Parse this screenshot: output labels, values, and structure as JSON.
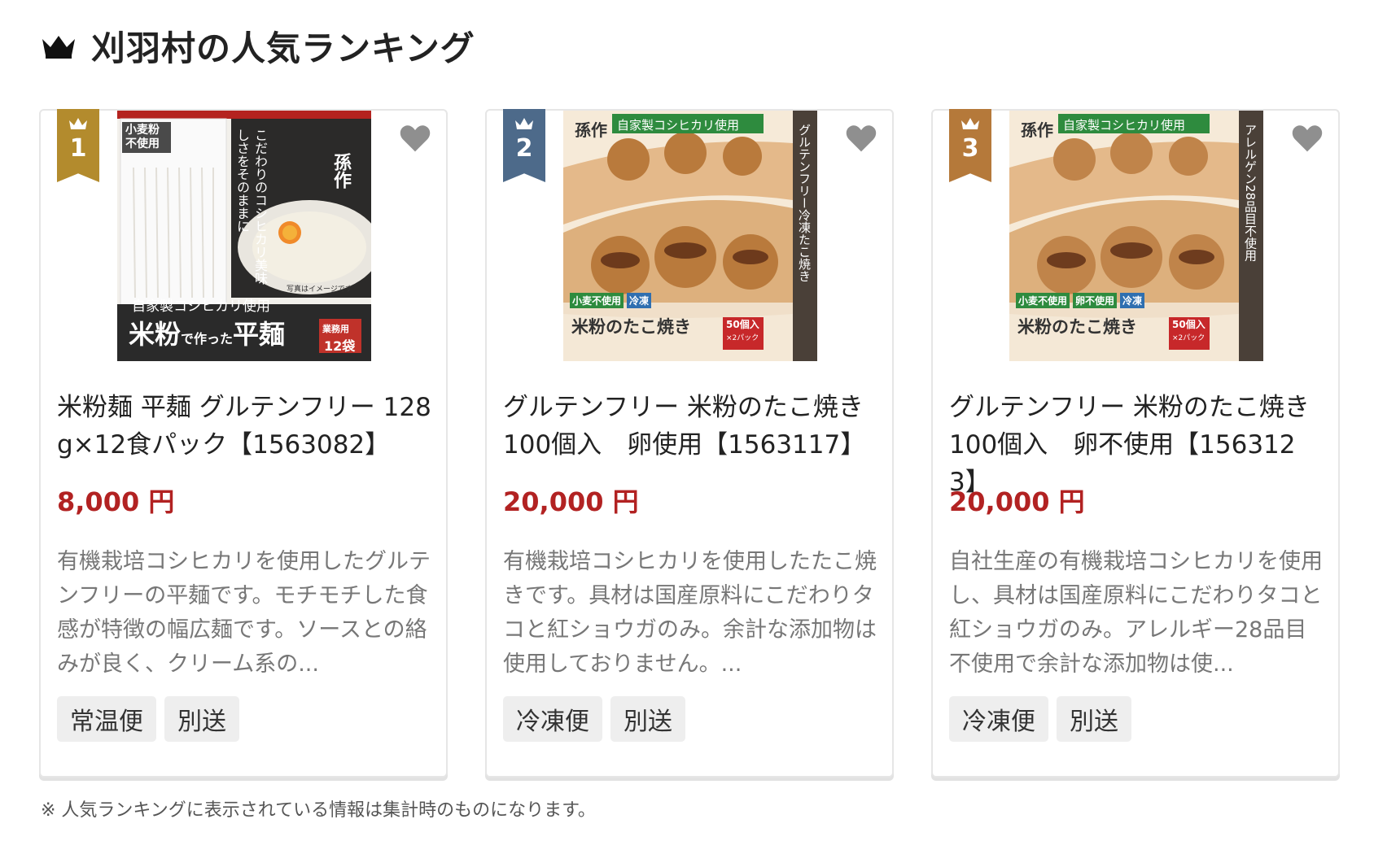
{
  "heading": {
    "title": "刈羽村の人気ランキング"
  },
  "cards": [
    {
      "rank": "1",
      "badge_color": "#b38b2d",
      "title": "米粉麺 平麺 グルテンフリー 128g×12食パック【1563082】",
      "price": "8,000 円",
      "description": "有機栽培コシヒカリを使用したグルテンフリーの平麺です。モチモチした食感が特徴の幅広麺です。ソースとの絡みが良く、クリーム系の...",
      "tags": [
        "常温便",
        "別送"
      ],
      "image": {
        "badge": "小麦粉 不使用",
        "vertical": "こだわりのコシヒカリ美味しさをそのままに",
        "brand": "孫作",
        "line1": "自家製コシヒカリ使用",
        "line2a": "米粉",
        "line2b": "で作った",
        "line2c": "平麺",
        "pack_a": "業務用",
        "pack_b": "12袋",
        "note": "写真はイメージです"
      }
    },
    {
      "rank": "2",
      "badge_color": "#4d6a8a",
      "title": "グルテンフリー 米粉のたこ焼き 100個入　卵使用【1563117】",
      "price": "20,000 円",
      "description": "有機栽培コシヒカリを使用したたこ焼きです。具材は国産原料にこだわりタコと紅ショウガのみ。余計な添加物は使用しておりません。...",
      "tags": [
        "冷凍便",
        "別送"
      ],
      "image": {
        "brand": "孫作",
        "top_banner": "自家製コシヒカリ使用",
        "side": "グルテンフリー冷凍たこ焼き",
        "labels": [
          "小麦不使用",
          "冷凍"
        ],
        "name": "米粉のたこ焼き",
        "count_a": "50個入",
        "count_b": "×2パック"
      }
    },
    {
      "rank": "3",
      "badge_color": "#b5793a",
      "title": "グルテンフリー 米粉のたこ焼き 100個入　卵不使用【1563123】",
      "price": "20,000 円",
      "description": "自社生産の有機栽培コシヒカリを使用し、具材は国産原料にこだわりタコと紅ショウガのみ。アレルギー28品目不使用で余計な添加物は使...",
      "tags": [
        "冷凍便",
        "別送"
      ],
      "image": {
        "brand": "孫作",
        "top_banner": "自家製コシヒカリ使用",
        "side": "アレルゲン28品目不使用",
        "labels": [
          "小麦不使用",
          "卵不使用",
          "冷凍"
        ],
        "name": "米粉のたこ焼き",
        "count_a": "50個入",
        "count_b": "×2パック"
      }
    }
  ],
  "footnote": "※ 人気ランキングに表示されている情報は集計時のものになります。"
}
